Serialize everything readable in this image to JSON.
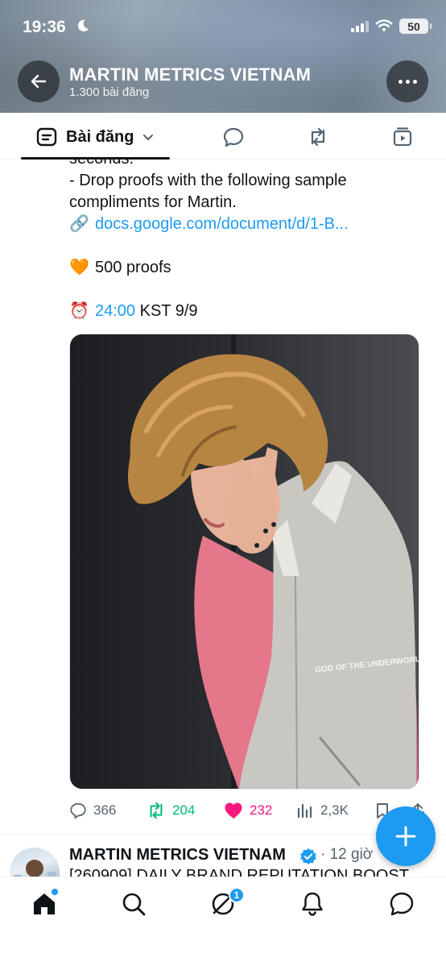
{
  "status": {
    "time": "19:36",
    "battery": "50"
  },
  "profile": {
    "name": "MARTIN METRICS VIETNAM",
    "posts": "1.300 bài đăng"
  },
  "tabs": {
    "main_label": "Bài đăng"
  },
  "tweet": {
    "line1": "seconds.",
    "line2": "- Drop proofs with the following sample",
    "line3": "compliments for Martin.",
    "link_emoji": "🔗",
    "link_text": "docs.google.com/document/d/1-B...",
    "heart_emoji": "🧡",
    "proofs_text": "500 proofs",
    "clock_emoji": "⏰",
    "time_link": "24:00",
    "time_rest": " KST 9/9",
    "photo_text": "GOD OF THE UNDERWORLD"
  },
  "actions": {
    "replies": "366",
    "retweets": "204",
    "likes": "232",
    "views": "2,3K"
  },
  "next_post": {
    "name": "MARTIN METRICS VIETNAM",
    "time": "· 12 giờ",
    "text": "[260909] DAILY BRAND REPUTATION BOOST"
  },
  "bottom_nav": {
    "badge": "1"
  },
  "colors": {
    "accent": "#1d9bf0",
    "retweet": "#00ba7c",
    "like": "#f91880",
    "muted": "#536471"
  }
}
